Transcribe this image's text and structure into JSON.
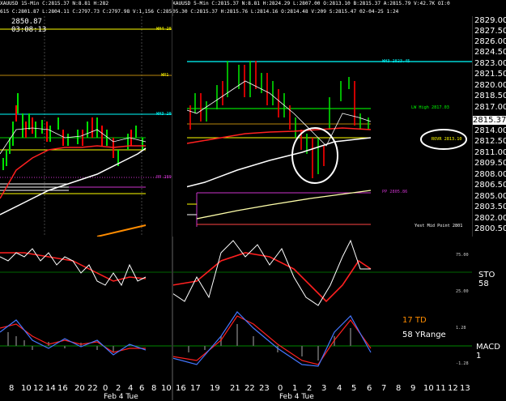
{
  "left_panel": {
    "header_line1": "XAUUSD 15-Min C:2815.37 N:8.81 H:282",
    "header_line2": "615 C:2801.87 L:2804.11 C:2797.73 C:2797.98 V:1,156 C:2850.87 02-03-25",
    "price_label": "2850.87",
    "time_label": "03:08:13",
    "levels": {
      "wh4": "WH4 2847",
      "wr1": "WR1 2",
      "wh3": "WH3 282",
      "pp": "PP 2805"
    },
    "x_ticks": [
      "8",
      "10",
      "12",
      "14",
      "16",
      "20",
      "22",
      "0",
      "2",
      "4",
      "6",
      "8",
      "10"
    ],
    "date_label": "Feb 4 Tue"
  },
  "right_panel": {
    "header_line1": "XAUUSD 5-Min C:2815.37 N:8.81 H:2824.29 L:2807.00 O:2813.10 B:2815.37 A:2815.79 V:42.7K OI:0",
    "header_line2": "05.30 C:2815.37 H:2815.76 L:2814.16 O:2814.48 V:209 S:2815.47 02-04-25 1:24",
    "levels": {
      "wh3": "WH3 2823.45",
      "lw_high": "LW High 2817.03",
      "rovr": "ROVR 2813.10",
      "pp": "PP 2805.86",
      "mid": "Yest Mid Point 2801"
    },
    "x_ticks": [
      "16",
      "17",
      "19",
      "21",
      "22",
      "23",
      "0",
      "1",
      "2",
      "3",
      "4",
      "5",
      "6",
      "7",
      "8",
      "9",
      "10",
      "11",
      "12",
      "13"
    ],
    "date_label": "Feb 4 Tue"
  },
  "price_axis": {
    "ticks": [
      "2829.00",
      "2827.50",
      "2826.00",
      "2824.50",
      "2823.00",
      "2821.50",
      "2820.00",
      "2818.50",
      "2817.00",
      "2815.37",
      "2814.00",
      "2812.50",
      "2811.00",
      "2809.50",
      "2808.00",
      "2806.50",
      "2805.00",
      "2803.50",
      "2802.00",
      "2800.50"
    ],
    "current": "2815.37"
  },
  "stochastic": {
    "label": "STO 58",
    "ticks": [
      "75.00",
      "25.00"
    ]
  },
  "macd": {
    "label": "MACD 1",
    "ticks": [
      "1.28",
      "-1.28"
    ],
    "td_label": "17 TD",
    "yrange_label": "58 YRange"
  },
  "colors": {
    "yellow": "#ffff00",
    "cyan": "#00ffff",
    "green": "#00e000",
    "red": "#ff0000",
    "white": "#ffffff",
    "magenta": "#cc33cc",
    "orange": "#ff8c00",
    "brown": "#b8860b"
  }
}
